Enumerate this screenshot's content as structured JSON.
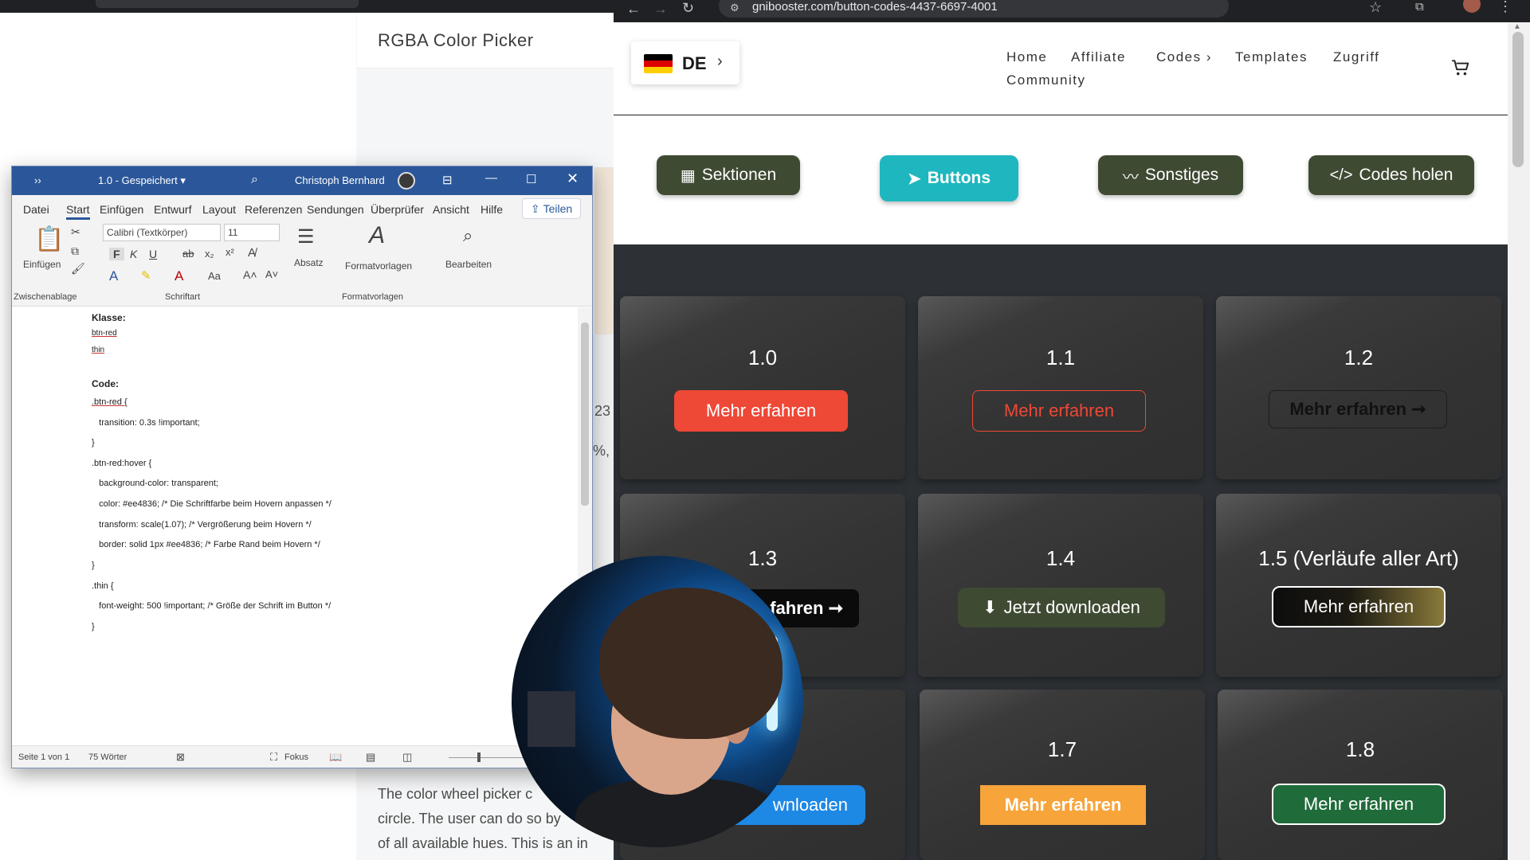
{
  "background_page": {
    "title": "RGBA Color Picker",
    "fragment_1": "23",
    "fragment_2": "%,",
    "body_lines": [
      "The color wheel picker c",
      "circle. The user can do so by",
      "of all available hues. This is an in"
    ]
  },
  "browser": {
    "url": "gnibooster.com/button-codes-4437-6697-4001",
    "site": {
      "language": "DE",
      "nav": [
        "Home",
        "Affiliate",
        "Codes ›",
        "Templates",
        "Zugriff",
        "Community"
      ],
      "menu_buttons": [
        {
          "label": "Sektionen",
          "icon": "grid-icon",
          "color": "#3f4a33"
        },
        {
          "label": "Buttons",
          "icon": "cursor-icon",
          "color": "#1fb7bf"
        },
        {
          "label": "Sonstiges",
          "icon": "scribble-icon",
          "color": "#3f4a33"
        },
        {
          "label": "Codes holen",
          "icon": "code-icon",
          "color": "#3f4a33"
        }
      ],
      "cards": [
        {
          "title": "1.0",
          "button": "Mehr erfahren"
        },
        {
          "title": "1.1",
          "button": "Mehr erfahren"
        },
        {
          "title": "1.2",
          "button": "Mehr erfahren ➞"
        },
        {
          "title": "1.3",
          "button": "fahren ➞"
        },
        {
          "title": "1.4",
          "button": "Jetzt downloaden"
        },
        {
          "title": "1.5 (Verläufe aller Art)",
          "button": "Mehr erfahren"
        },
        {
          "title": "",
          "button": "wnloaden"
        },
        {
          "title": "1.7",
          "button": "Mehr erfahren"
        },
        {
          "title": "1.8",
          "button": "Mehr erfahren"
        }
      ]
    }
  },
  "word": {
    "quick_access": "››",
    "doc_name": "1.0 - Gespeichert ▾",
    "user": "Christoph Bernhard",
    "menu": [
      "Datei",
      "Start",
      "Einfügen",
      "Entwurf",
      "Layout",
      "Referenzen",
      "Sendungen",
      "Überprüfer",
      "Ansicht",
      "Hilfe"
    ],
    "share": "Teilen",
    "ribbon": {
      "paste": "Einfügen",
      "clipboard": "Zwischenablage",
      "font_name": "Calibri (Textkörper)",
      "font_size": "11",
      "font_group": "Schriftart",
      "paragraph": "Absatz",
      "styles": "Formatvorlagen",
      "styles_group": "Formatvorlagen",
      "edit": "Bearbeiten"
    },
    "doc_lines": [
      {
        "text": "Klasse:",
        "bold": true
      },
      {
        "text": "btn-red"
      },
      {
        "text": "thin"
      },
      {
        "text": ""
      },
      {
        "text": "Code:",
        "bold": true
      },
      {
        "text": ".btn-red {"
      },
      {
        "text": "   transition: 0.3s !important;"
      },
      {
        "text": "}"
      },
      {
        "text": ".btn-red:hover {"
      },
      {
        "text": "   background-color: transparent;"
      },
      {
        "text": "   color: #ee4836; /* Die Schriftfarbe beim Hovern anpassen */"
      },
      {
        "text": "   transform: scale(1.07); /* Vergrößerung beim Hovern */"
      },
      {
        "text": "   border: solid 1px #ee4836; /* Farbe Rand beim Hovern */"
      },
      {
        "text": "}"
      },
      {
        "text": ".thin {"
      },
      {
        "text": "   font-weight: 500 !important; /* Größe der Schrift im Button */"
      },
      {
        "text": "}"
      }
    ],
    "status": {
      "page": "Seite 1 von 1",
      "words": "75 Wörter",
      "focus": "Fokus"
    }
  }
}
